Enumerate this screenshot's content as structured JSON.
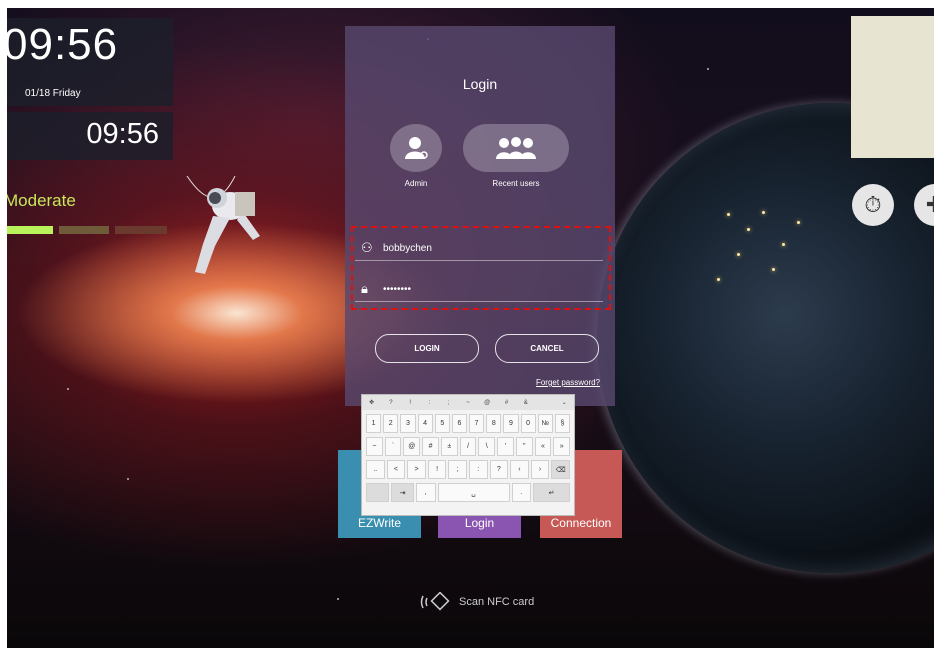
{
  "clock_widget": {
    "time_large": "09:56",
    "date": "01/18 Friday",
    "time_small": "09:56"
  },
  "weather": {
    "label": "Moderate",
    "bar_colors": [
      "#b9f25b",
      "#6f5a3a",
      "#6a3a2e"
    ]
  },
  "login": {
    "title": "Login",
    "admin_label": "Admin",
    "recent_users_label": "Recent users",
    "username_value": "bobbychen",
    "password_value": "••••••••",
    "login_button": "LOGIN",
    "cancel_button": "CANCEL",
    "forget_password": "Forget password?"
  },
  "keyboard": {
    "top_row": [
      "✥",
      "?",
      "!",
      ":",
      ";",
      "~",
      "@",
      "#",
      "&",
      "",
      "⌄"
    ],
    "rows": [
      [
        "1",
        "2",
        "3",
        "4",
        "5",
        "6",
        "7",
        "8",
        "9",
        "0",
        "№",
        "§"
      ],
      [
        "~",
        "`",
        "@",
        "#",
        "±",
        "/",
        "\\",
        "'",
        "\"",
        "«",
        "»"
      ],
      [
        "..",
        "<",
        ">",
        "!",
        ";",
        ":",
        "?",
        "‹",
        "›",
        "⌫"
      ],
      [
        "",
        "⇥",
        ",",
        "␣",
        ".",
        "↵"
      ]
    ]
  },
  "tiles": {
    "ezwrite": "EZWrite",
    "login": "Login",
    "connection": "Connection"
  },
  "nfc_text": "Scan NFC card",
  "icons": {
    "timer": "stopwatch-icon",
    "tools": "tools-icon",
    "nfc": "nfc-icon"
  },
  "colors": {
    "accent_red": "#e01010",
    "panel": "#58486e"
  }
}
